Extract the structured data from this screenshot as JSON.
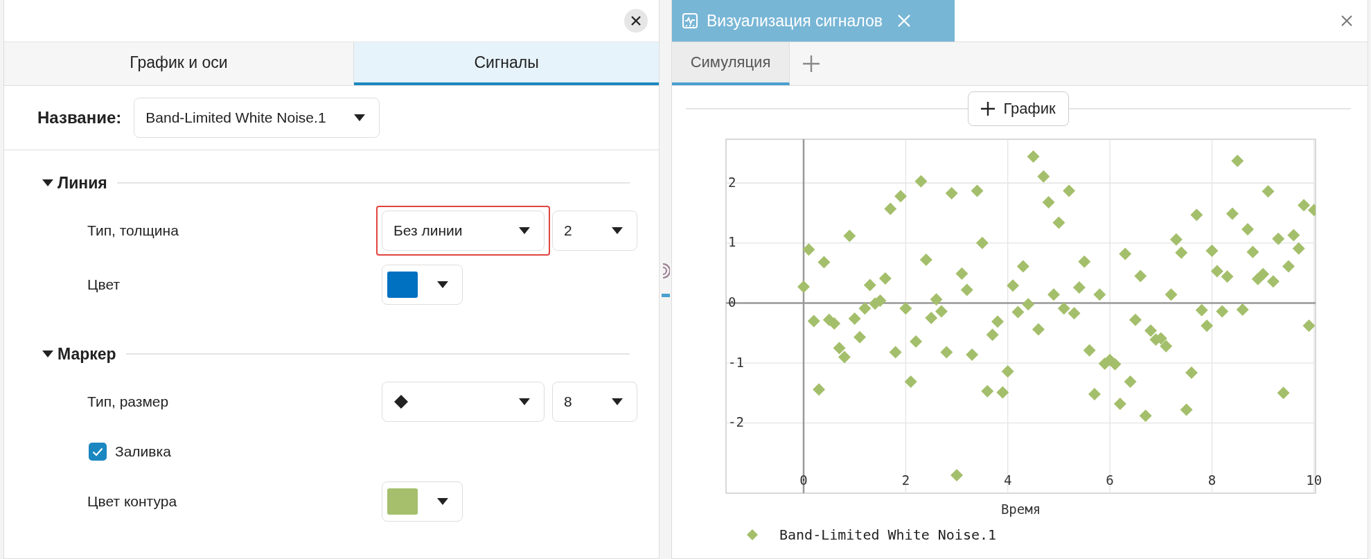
{
  "left_panel": {
    "tabs": [
      {
        "label": "График и оси",
        "selected": false
      },
      {
        "label": "Сигналы",
        "selected": true
      }
    ],
    "name_label": "Название:",
    "name_value": "Band-Limited White Noise.1",
    "sections": [
      {
        "title": "Линия",
        "expanded": true,
        "rows": [
          {
            "kind": "select_pair",
            "label": "Тип, толщина",
            "value": "Без линии",
            "size": "2",
            "highlighted": true
          },
          {
            "kind": "color",
            "label": "Цвет",
            "color": "#0070c0"
          }
        ]
      },
      {
        "title": "Маркер",
        "expanded": true,
        "rows": [
          {
            "kind": "marker_pair",
            "label": "Тип, размер",
            "size": "8",
            "highlighted": false
          },
          {
            "kind": "checkbox",
            "label": "Заливка",
            "checked": true
          },
          {
            "kind": "color",
            "label": "Цвет контура",
            "color": "#a5bf6d"
          }
        ]
      }
    ]
  },
  "right_panel": {
    "tabs": [
      {
        "label": "Визуализация сигналов",
        "selected": true
      }
    ],
    "subtabs": [
      {
        "label": "Симуляция",
        "selected": true
      }
    ],
    "add_plot_button": "График",
    "chart_data": {
      "type": "scatter",
      "grid": true,
      "xlabel": "Время",
      "xlim": [
        -1.52,
        10.03
      ],
      "ylim": [
        -3.17,
        2.73
      ],
      "xticks": [
        0,
        2,
        4,
        6,
        8,
        10
      ],
      "yticks": [
        -2,
        -1,
        0,
        1,
        2
      ],
      "x": [
        0,
        0.1,
        0.2,
        0.3,
        0.4,
        0.5,
        0.6,
        0.7,
        0.8,
        0.9,
        1,
        1.1,
        1.2,
        1.3,
        1.4,
        1.5,
        1.6,
        1.7,
        1.8,
        1.9,
        2,
        2.1,
        2.2,
        2.3,
        2.4,
        2.5,
        2.6,
        2.7,
        2.8,
        2.9,
        3,
        3.1,
        3.2,
        3.3,
        3.4,
        3.5,
        3.6,
        3.7,
        3.8,
        3.9,
        4,
        4.1,
        4.2,
        4.3,
        4.4,
        4.5,
        4.6,
        4.7,
        4.8,
        4.9,
        5,
        5.1,
        5.2,
        5.3,
        5.4,
        5.5,
        5.6,
        5.7,
        5.8,
        5.9,
        6,
        6.1,
        6.2,
        6.3,
        6.4,
        6.5,
        6.6,
        6.7,
        6.8,
        6.9,
        7,
        7.1,
        7.2,
        7.3,
        7.4,
        7.5,
        7.6,
        7.7,
        7.8,
        7.9,
        8,
        8.1,
        8.2,
        8.3,
        8.4,
        8.5,
        8.6,
        8.7,
        8.8,
        8.9,
        9,
        9.1,
        9.2,
        9.3,
        9.4,
        9.5,
        9.6,
        9.7,
        9.8,
        9.9,
        10
      ],
      "series": [
        {
          "name": "Band-Limited White Noise.1",
          "color": "#a4bf6b",
          "values": [
            0.27,
            0.89,
            -0.3,
            -1.44,
            0.68,
            -0.28,
            -0.34,
            -0.75,
            -0.9,
            1.12,
            -0.26,
            -0.57,
            -0.09,
            0.3,
            -0.01,
            0.04,
            0.41,
            1.57,
            -0.82,
            1.78,
            -0.09,
            -1.31,
            -0.64,
            2.03,
            0.72,
            -0.25,
            0.06,
            -0.14,
            -0.82,
            1.83,
            -2.87,
            0.49,
            0.22,
            -0.86,
            1.87,
            1,
            -1.47,
            -0.53,
            -0.31,
            -1.49,
            -1.14,
            0.29,
            -0.15,
            0.61,
            -0.02,
            2.44,
            -0.44,
            2.11,
            1.68,
            0.14,
            1.34,
            -0.09,
            1.87,
            -0.17,
            0.26,
            0.69,
            -0.79,
            -1.52,
            0.14,
            -1.01,
            -0.95,
            -1.02,
            -1.68,
            0.82,
            -1.31,
            -0.28,
            0.45,
            -1.88,
            -0.46,
            -0.61,
            -0.59,
            -0.72,
            0.14,
            1.06,
            0.84,
            -1.78,
            -1.16,
            1.47,
            -0.12,
            -0.38,
            0.87,
            0.53,
            -0.14,
            0.44,
            1.49,
            2.37,
            -0.11,
            1.23,
            0.85,
            0.4,
            0.48,
            1.86,
            0.36,
            1.07,
            -1.5,
            0.61,
            1.13,
            0.91,
            1.63,
            -0.38,
            1.55
          ]
        }
      ]
    }
  }
}
